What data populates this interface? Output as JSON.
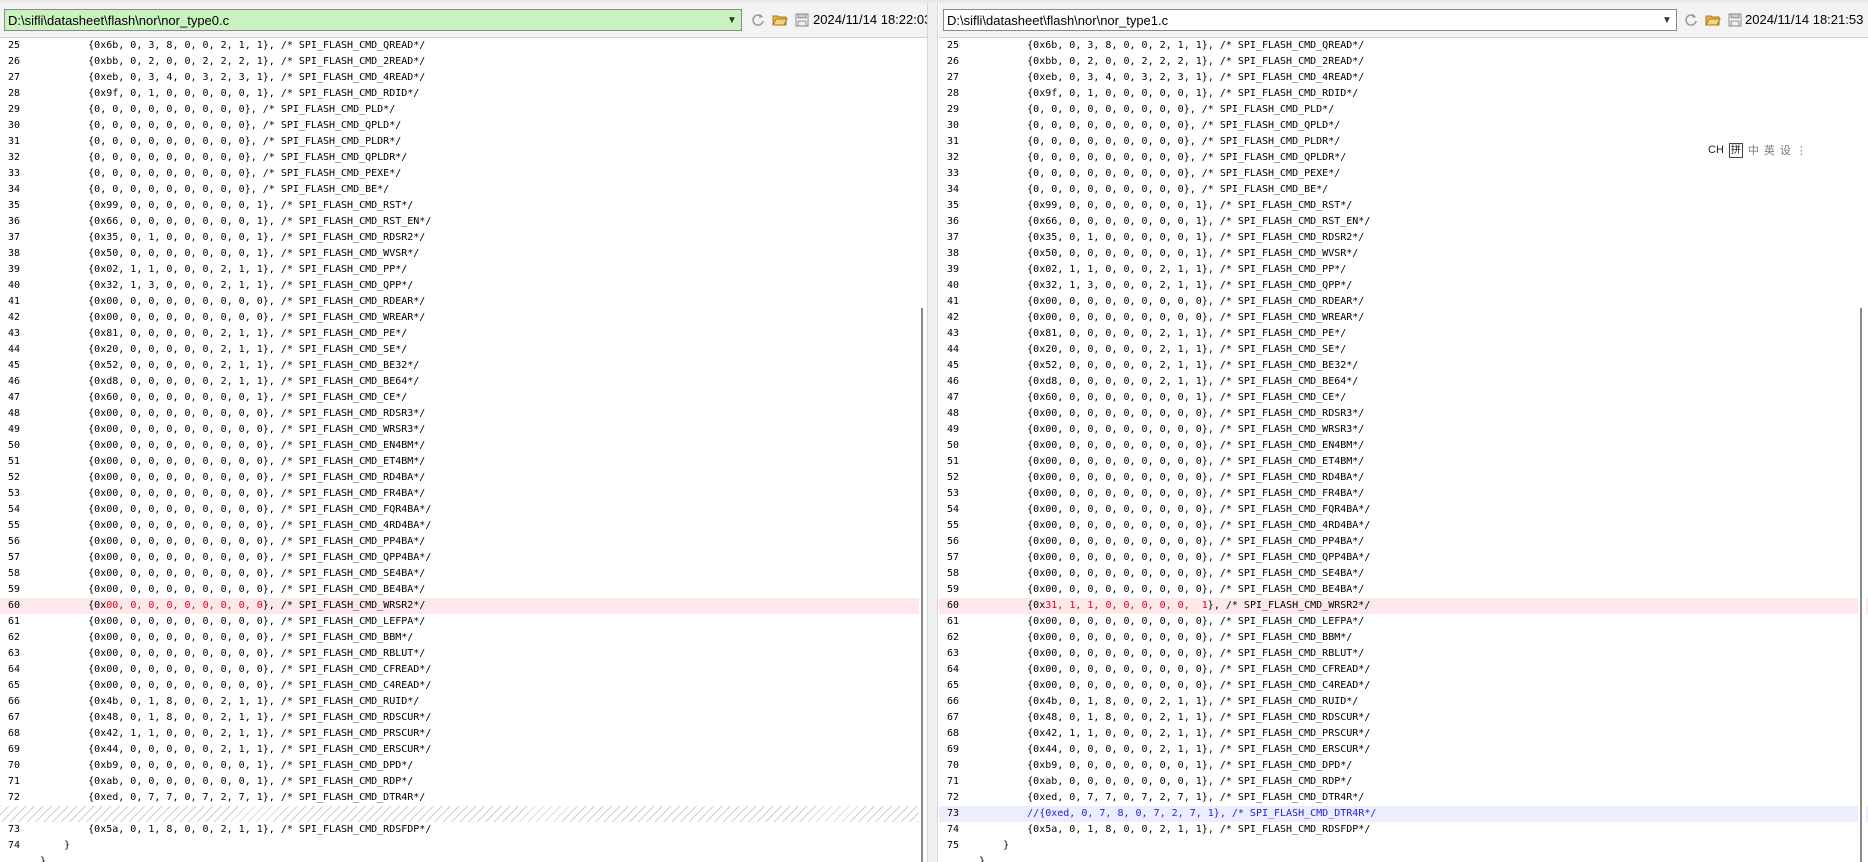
{
  "left": {
    "path": "D:\\sifli\\datasheet\\flash\\nor\\nor_type0.c",
    "timestamp": "2024/11/14 18:22:03",
    "path_bg": "#c9f2c0",
    "lines": [
      {
        "n": "25",
        "t": "        {0x6b, 0, 3, 8, 0, 0, 2, 1, 1}, /* SPI_FLASH_CMD_QREAD*/"
      },
      {
        "n": "26",
        "t": "        {0xbb, 0, 2, 0, 0, 2, 2, 2, 1}, /* SPI_FLASH_CMD_2READ*/"
      },
      {
        "n": "27",
        "t": "        {0xeb, 0, 3, 4, 0, 3, 2, 3, 1}, /* SPI_FLASH_CMD_4READ*/"
      },
      {
        "n": "28",
        "t": "        {0x9f, 0, 1, 0, 0, 0, 0, 0, 1}, /* SPI_FLASH_CMD_RDID*/"
      },
      {
        "n": "29",
        "t": "        {0, 0, 0, 0, 0, 0, 0, 0, 0}, /* SPI_FLASH_CMD_PLD*/"
      },
      {
        "n": "30",
        "t": "        {0, 0, 0, 0, 0, 0, 0, 0, 0}, /* SPI_FLASH_CMD_QPLD*/"
      },
      {
        "n": "31",
        "t": "        {0, 0, 0, 0, 0, 0, 0, 0, 0}, /* SPI_FLASH_CMD_PLDR*/"
      },
      {
        "n": "32",
        "t": "        {0, 0, 0, 0, 0, 0, 0, 0, 0}, /* SPI_FLASH_CMD_QPLDR*/"
      },
      {
        "n": "33",
        "t": "        {0, 0, 0, 0, 0, 0, 0, 0, 0}, /* SPI_FLASH_CMD_PEXE*/"
      },
      {
        "n": "34",
        "t": "        {0, 0, 0, 0, 0, 0, 0, 0, 0}, /* SPI_FLASH_CMD_BE*/"
      },
      {
        "n": "35",
        "t": "        {0x99, 0, 0, 0, 0, 0, 0, 0, 1}, /* SPI_FLASH_CMD_RST*/"
      },
      {
        "n": "36",
        "t": "        {0x66, 0, 0, 0, 0, 0, 0, 0, 1}, /* SPI_FLASH_CMD_RST_EN*/"
      },
      {
        "n": "37",
        "t": "        {0x35, 0, 1, 0, 0, 0, 0, 0, 1}, /* SPI_FLASH_CMD_RDSR2*/"
      },
      {
        "n": "38",
        "t": "        {0x50, 0, 0, 0, 0, 0, 0, 0, 1}, /* SPI_FLASH_CMD_WVSR*/"
      },
      {
        "n": "39",
        "t": "        {0x02, 1, 1, 0, 0, 0, 2, 1, 1}, /* SPI_FLASH_CMD_PP*/"
      },
      {
        "n": "40",
        "t": "        {0x32, 1, 3, 0, 0, 0, 2, 1, 1}, /* SPI_FLASH_CMD_QPP*/"
      },
      {
        "n": "41",
        "t": "        {0x00, 0, 0, 0, 0, 0, 0, 0, 0}, /* SPI_FLASH_CMD_RDEAR*/"
      },
      {
        "n": "42",
        "t": "        {0x00, 0, 0, 0, 0, 0, 0, 0, 0}, /* SPI_FLASH_CMD_WREAR*/"
      },
      {
        "n": "43",
        "t": "        {0x81, 0, 0, 0, 0, 0, 2, 1, 1}, /* SPI_FLASH_CMD_PE*/"
      },
      {
        "n": "44",
        "t": "        {0x20, 0, 0, 0, 0, 0, 2, 1, 1}, /* SPI_FLASH_CMD_SE*/"
      },
      {
        "n": "45",
        "t": "        {0x52, 0, 0, 0, 0, 0, 2, 1, 1}, /* SPI_FLASH_CMD_BE32*/"
      },
      {
        "n": "46",
        "t": "        {0xd8, 0, 0, 0, 0, 0, 2, 1, 1}, /* SPI_FLASH_CMD_BE64*/"
      },
      {
        "n": "47",
        "t": "        {0x60, 0, 0, 0, 0, 0, 0, 0, 1}, /* SPI_FLASH_CMD_CE*/"
      },
      {
        "n": "48",
        "t": "        {0x00, 0, 0, 0, 0, 0, 0, 0, 0}, /* SPI_FLASH_CMD_RDSR3*/"
      },
      {
        "n": "49",
        "t": "        {0x00, 0, 0, 0, 0, 0, 0, 0, 0}, /* SPI_FLASH_CMD_WRSR3*/"
      },
      {
        "n": "50",
        "t": "        {0x00, 0, 0, 0, 0, 0, 0, 0, 0}, /* SPI_FLASH_CMD_EN4BM*/"
      },
      {
        "n": "51",
        "t": "        {0x00, 0, 0, 0, 0, 0, 0, 0, 0}, /* SPI_FLASH_CMD_ET4BM*/"
      },
      {
        "n": "52",
        "t": "        {0x00, 0, 0, 0, 0, 0, 0, 0, 0}, /* SPI_FLASH_CMD_RD4BA*/"
      },
      {
        "n": "53",
        "t": "        {0x00, 0, 0, 0, 0, 0, 0, 0, 0}, /* SPI_FLASH_CMD_FR4BA*/"
      },
      {
        "n": "54",
        "t": "        {0x00, 0, 0, 0, 0, 0, 0, 0, 0}, /* SPI_FLASH_CMD_FQR4BA*/"
      },
      {
        "n": "55",
        "t": "        {0x00, 0, 0, 0, 0, 0, 0, 0, 0}, /* SPI_FLASH_CMD_4RD4BA*/"
      },
      {
        "n": "56",
        "t": "        {0x00, 0, 0, 0, 0, 0, 0, 0, 0}, /* SPI_FLASH_CMD_PP4BA*/"
      },
      {
        "n": "57",
        "t": "        {0x00, 0, 0, 0, 0, 0, 0, 0, 0}, /* SPI_FLASH_CMD_QPP4BA*/"
      },
      {
        "n": "58",
        "t": "        {0x00, 0, 0, 0, 0, 0, 0, 0, 0}, /* SPI_FLASH_CMD_SE4BA*/"
      },
      {
        "n": "59",
        "t": "        {0x00, 0, 0, 0, 0, 0, 0, 0, 0}, /* SPI_FLASH_CMD_BE4BA*/"
      },
      {
        "n": "60",
        "t": "        {0x00, 0, 0, 0, 0, 0, 0, 0, 0}, /* SPI_FLASH_CMD_WRSR2*/",
        "hl": "red",
        "pre": "        {0x",
        "red": "00, 0, 0, 0, 0, 0, 0, 0, 0",
        "post": "}, /* SPI_FLASH_CMD_WRSR2*/"
      },
      {
        "n": "61",
        "t": "        {0x00, 0, 0, 0, 0, 0, 0, 0, 0}, /* SPI_FLASH_CMD_LEFPA*/"
      },
      {
        "n": "62",
        "t": "        {0x00, 0, 0, 0, 0, 0, 0, 0, 0}, /* SPI_FLASH_CMD_BBM*/"
      },
      {
        "n": "63",
        "t": "        {0x00, 0, 0, 0, 0, 0, 0, 0, 0}, /* SPI_FLASH_CMD_RBLUT*/"
      },
      {
        "n": "64",
        "t": "        {0x00, 0, 0, 0, 0, 0, 0, 0, 0}, /* SPI_FLASH_CMD_CFREAD*/"
      },
      {
        "n": "65",
        "t": "        {0x00, 0, 0, 0, 0, 0, 0, 0, 0}, /* SPI_FLASH_CMD_C4READ*/"
      },
      {
        "n": "66",
        "t": "        {0x4b, 0, 1, 8, 0, 0, 2, 1, 1}, /* SPI_FLASH_CMD_RUID*/"
      },
      {
        "n": "67",
        "t": "        {0x48, 0, 1, 8, 0, 0, 2, 1, 1}, /* SPI_FLASH_CMD_RDSCUR*/"
      },
      {
        "n": "68",
        "t": "        {0x42, 1, 1, 0, 0, 0, 2, 1, 1}, /* SPI_FLASH_CMD_PRSCUR*/"
      },
      {
        "n": "69",
        "t": "        {0x44, 0, 0, 0, 0, 0, 2, 1, 1}, /* SPI_FLASH_CMD_ERSCUR*/"
      },
      {
        "n": "70",
        "t": "        {0xb9, 0, 0, 0, 0, 0, 0, 0, 1}, /* SPI_FLASH_CMD_DPD*/"
      },
      {
        "n": "71",
        "t": "        {0xab, 0, 0, 0, 0, 0, 0, 0, 1}, /* SPI_FLASH_CMD_RDP*/"
      },
      {
        "n": "72",
        "t": "        {0xed, 0, 7, 7, 0, 7, 2, 7, 1}, /* SPI_FLASH_CMD_DTR4R*/"
      },
      {
        "n": "",
        "t": "",
        "hatch": true
      },
      {
        "n": "73",
        "t": "        {0x5a, 0, 1, 8, 0, 0, 2, 1, 1}, /* SPI_FLASH_CMD_RDSFDP*/"
      },
      {
        "n": "74",
        "t": "    }"
      },
      {
        "n": "",
        "t": "}"
      }
    ]
  },
  "right": {
    "path": "D:\\sifli\\datasheet\\flash\\nor\\nor_type1.c",
    "timestamp": "2024/11/14 18:21:53",
    "path_bg": "#ffffff",
    "lines": [
      {
        "n": "25",
        "t": "        {0x6b, 0, 3, 8, 0, 0, 2, 1, 1}, /* SPI_FLASH_CMD_QREAD*/"
      },
      {
        "n": "26",
        "t": "        {0xbb, 0, 2, 0, 0, 2, 2, 2, 1}, /* SPI_FLASH_CMD_2READ*/"
      },
      {
        "n": "27",
        "t": "        {0xeb, 0, 3, 4, 0, 3, 2, 3, 1}, /* SPI_FLASH_CMD_4READ*/"
      },
      {
        "n": "28",
        "t": "        {0x9f, 0, 1, 0, 0, 0, 0, 0, 1}, /* SPI_FLASH_CMD_RDID*/"
      },
      {
        "n": "29",
        "t": "        {0, 0, 0, 0, 0, 0, 0, 0, 0}, /* SPI_FLASH_CMD_PLD*/"
      },
      {
        "n": "30",
        "t": "        {0, 0, 0, 0, 0, 0, 0, 0, 0}, /* SPI_FLASH_CMD_QPLD*/"
      },
      {
        "n": "31",
        "t": "        {0, 0, 0, 0, 0, 0, 0, 0, 0}, /* SPI_FLASH_CMD_PLDR*/"
      },
      {
        "n": "32",
        "t": "        {0, 0, 0, 0, 0, 0, 0, 0, 0}, /* SPI_FLASH_CMD_QPLDR*/"
      },
      {
        "n": "33",
        "t": "        {0, 0, 0, 0, 0, 0, 0, 0, 0}, /* SPI_FLASH_CMD_PEXE*/"
      },
      {
        "n": "34",
        "t": "        {0, 0, 0, 0, 0, 0, 0, 0, 0}, /* SPI_FLASH_CMD_BE*/"
      },
      {
        "n": "35",
        "t": "        {0x99, 0, 0, 0, 0, 0, 0, 0, 1}, /* SPI_FLASH_CMD_RST*/"
      },
      {
        "n": "36",
        "t": "        {0x66, 0, 0, 0, 0, 0, 0, 0, 1}, /* SPI_FLASH_CMD_RST_EN*/"
      },
      {
        "n": "37",
        "t": "        {0x35, 0, 1, 0, 0, 0, 0, 0, 1}, /* SPI_FLASH_CMD_RDSR2*/"
      },
      {
        "n": "38",
        "t": "        {0x50, 0, 0, 0, 0, 0, 0, 0, 1}, /* SPI_FLASH_CMD_WVSR*/"
      },
      {
        "n": "39",
        "t": "        {0x02, 1, 1, 0, 0, 0, 2, 1, 1}, /* SPI_FLASH_CMD_PP*/"
      },
      {
        "n": "40",
        "t": "        {0x32, 1, 3, 0, 0, 0, 2, 1, 1}, /* SPI_FLASH_CMD_QPP*/"
      },
      {
        "n": "41",
        "t": "        {0x00, 0, 0, 0, 0, 0, 0, 0, 0}, /* SPI_FLASH_CMD_RDEAR*/"
      },
      {
        "n": "42",
        "t": "        {0x00, 0, 0, 0, 0, 0, 0, 0, 0}, /* SPI_FLASH_CMD_WREAR*/"
      },
      {
        "n": "43",
        "t": "        {0x81, 0, 0, 0, 0, 0, 2, 1, 1}, /* SPI_FLASH_CMD_PE*/"
      },
      {
        "n": "44",
        "t": "        {0x20, 0, 0, 0, 0, 0, 2, 1, 1}, /* SPI_FLASH_CMD_SE*/"
      },
      {
        "n": "45",
        "t": "        {0x52, 0, 0, 0, 0, 0, 2, 1, 1}, /* SPI_FLASH_CMD_BE32*/"
      },
      {
        "n": "46",
        "t": "        {0xd8, 0, 0, 0, 0, 0, 2, 1, 1}, /* SPI_FLASH_CMD_BE64*/"
      },
      {
        "n": "47",
        "t": "        {0x60, 0, 0, 0, 0, 0, 0, 0, 1}, /* SPI_FLASH_CMD_CE*/"
      },
      {
        "n": "48",
        "t": "        {0x00, 0, 0, 0, 0, 0, 0, 0, 0}, /* SPI_FLASH_CMD_RDSR3*/"
      },
      {
        "n": "49",
        "t": "        {0x00, 0, 0, 0, 0, 0, 0, 0, 0}, /* SPI_FLASH_CMD_WRSR3*/"
      },
      {
        "n": "50",
        "t": "        {0x00, 0, 0, 0, 0, 0, 0, 0, 0}, /* SPI_FLASH_CMD_EN4BM*/"
      },
      {
        "n": "51",
        "t": "        {0x00, 0, 0, 0, 0, 0, 0, 0, 0}, /* SPI_FLASH_CMD_ET4BM*/"
      },
      {
        "n": "52",
        "t": "        {0x00, 0, 0, 0, 0, 0, 0, 0, 0}, /* SPI_FLASH_CMD_RD4BA*/"
      },
      {
        "n": "53",
        "t": "        {0x00, 0, 0, 0, 0, 0, 0, 0, 0}, /* SPI_FLASH_CMD_FR4BA*/"
      },
      {
        "n": "54",
        "t": "        {0x00, 0, 0, 0, 0, 0, 0, 0, 0}, /* SPI_FLASH_CMD_FQR4BA*/"
      },
      {
        "n": "55",
        "t": "        {0x00, 0, 0, 0, 0, 0, 0, 0, 0}, /* SPI_FLASH_CMD_4RD4BA*/"
      },
      {
        "n": "56",
        "t": "        {0x00, 0, 0, 0, 0, 0, 0, 0, 0}, /* SPI_FLASH_CMD_PP4BA*/"
      },
      {
        "n": "57",
        "t": "        {0x00, 0, 0, 0, 0, 0, 0, 0, 0}, /* SPI_FLASH_CMD_QPP4BA*/"
      },
      {
        "n": "58",
        "t": "        {0x00, 0, 0, 0, 0, 0, 0, 0, 0}, /* SPI_FLASH_CMD_SE4BA*/"
      },
      {
        "n": "59",
        "t": "        {0x00, 0, 0, 0, 0, 0, 0, 0, 0}, /* SPI_FLASH_CMD_BE4BA*/"
      },
      {
        "n": "60",
        "t": "        {0x31, 1, 1, 0, 0, 0, 0, 0,  1}, /* SPI_FLASH_CMD_WRSR2*/",
        "hl": "red",
        "pre": "        {0x",
        "red": "31, 1, 1, 0, 0, 0, 0, 0,  1",
        "post": "}, /* SPI_FLASH_CMD_WRSR2*/"
      },
      {
        "n": "61",
        "t": "        {0x00, 0, 0, 0, 0, 0, 0, 0, 0}, /* SPI_FLASH_CMD_LEFPA*/"
      },
      {
        "n": "62",
        "t": "        {0x00, 0, 0, 0, 0, 0, 0, 0, 0}, /* SPI_FLASH_CMD_BBM*/"
      },
      {
        "n": "63",
        "t": "        {0x00, 0, 0, 0, 0, 0, 0, 0, 0}, /* SPI_FLASH_CMD_RBLUT*/"
      },
      {
        "n": "64",
        "t": "        {0x00, 0, 0, 0, 0, 0, 0, 0, 0}, /* SPI_FLASH_CMD_CFREAD*/"
      },
      {
        "n": "65",
        "t": "        {0x00, 0, 0, 0, 0, 0, 0, 0, 0}, /* SPI_FLASH_CMD_C4READ*/"
      },
      {
        "n": "66",
        "t": "        {0x4b, 0, 1, 8, 0, 0, 2, 1, 1}, /* SPI_FLASH_CMD_RUID*/"
      },
      {
        "n": "67",
        "t": "        {0x48, 0, 1, 8, 0, 0, 2, 1, 1}, /* SPI_FLASH_CMD_RDSCUR*/"
      },
      {
        "n": "68",
        "t": "        {0x42, 1, 1, 0, 0, 0, 2, 1, 1}, /* SPI_FLASH_CMD_PRSCUR*/"
      },
      {
        "n": "69",
        "t": "        {0x44, 0, 0, 0, 0, 0, 2, 1, 1}, /* SPI_FLASH_CMD_ERSCUR*/"
      },
      {
        "n": "70",
        "t": "        {0xb9, 0, 0, 0, 0, 0, 0, 0, 1}, /* SPI_FLASH_CMD_DPD*/"
      },
      {
        "n": "71",
        "t": "        {0xab, 0, 0, 0, 0, 0, 0, 0, 1}, /* SPI_FLASH_CMD_RDP*/"
      },
      {
        "n": "72",
        "t": "        {0xed, 0, 7, 7, 0, 7, 2, 7, 1}, /* SPI_FLASH_CMD_DTR4R*/"
      },
      {
        "n": "73",
        "t": "        //{0xed, 0, 7, 8, 0, 7, 2, 7, 1}, /* SPI_FLASH_CMD_DTR4R*/",
        "hl": "blue"
      },
      {
        "n": "74",
        "t": "        {0x5a, 0, 1, 8, 0, 0, 2, 1, 1}, /* SPI_FLASH_CMD_RDSFDP*/"
      },
      {
        "n": "75",
        "t": "    }"
      },
      {
        "n": "",
        "t": "}"
      }
    ]
  },
  "ime": {
    "label": "CH",
    "key": "拼",
    "extras": [
      "中",
      "英",
      "设",
      "⋮"
    ]
  },
  "icons": [
    "refresh-icon",
    "open-folder-icon",
    "save-icon",
    "chevron-down-icon"
  ]
}
